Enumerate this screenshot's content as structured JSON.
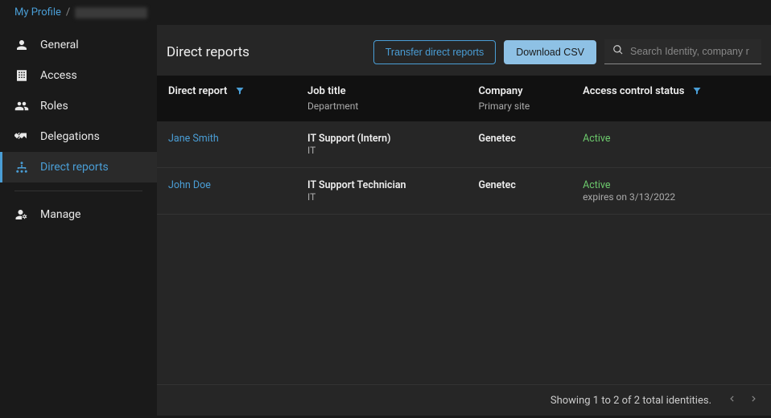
{
  "breadcrumb": {
    "root": "My Profile",
    "sep": "/"
  },
  "sidebar": {
    "items": [
      {
        "label": "General"
      },
      {
        "label": "Access"
      },
      {
        "label": "Roles"
      },
      {
        "label": "Delegations"
      },
      {
        "label": "Direct reports"
      }
    ],
    "manage": {
      "label": "Manage"
    }
  },
  "toolbar": {
    "title": "Direct reports",
    "transfer_label": "Transfer direct reports",
    "download_label": "Download CSV",
    "search_placeholder": "Search Identity, company r"
  },
  "columns": {
    "direct_report": "Direct report",
    "job_title": "Job title",
    "department": "Department",
    "company": "Company",
    "primary_site": "Primary site",
    "access_status": "Access control status"
  },
  "rows": [
    {
      "name": "Jane Smith",
      "job_title": "IT Support (Intern)",
      "department": "IT",
      "company": "Genetec",
      "status": "Active",
      "expires": ""
    },
    {
      "name": "John Doe",
      "job_title": "IT Support Technician",
      "department": "IT",
      "company": "Genetec",
      "status": "Active",
      "expires": "expires on 3/13/2022"
    }
  ],
  "footer": {
    "text": "Showing 1 to 2 of 2 total identities."
  }
}
